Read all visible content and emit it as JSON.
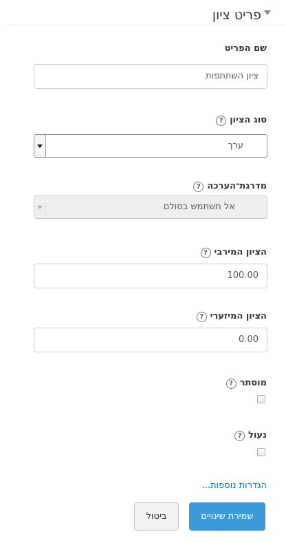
{
  "section": {
    "title": "פריט ציון"
  },
  "fields": {
    "item_name": {
      "label": "שם הפריט",
      "value": "ציון השתתפות"
    },
    "grade_type": {
      "label": "סוג הציון",
      "value": "ערך"
    },
    "scale": {
      "label": "מדרגת־הערכה",
      "value": "אל תשתמש בסולם"
    },
    "max_grade": {
      "label": "הציון המירבי",
      "value": "100.00"
    },
    "min_grade": {
      "label": "הציון המיזערי",
      "value": "0.00"
    },
    "hidden": {
      "label": "מוסתר",
      "checked": false
    },
    "locked": {
      "label": "נעול",
      "checked": false
    }
  },
  "help_glyph": "?",
  "more_settings_label": "הגדרות נוספות...",
  "buttons": {
    "save": "שמירת שינויים",
    "cancel": "ביטול"
  },
  "colors": {
    "primary": "#3d9ad8",
    "link": "#0f6fc5",
    "disabled_bg": "#eeeeee"
  }
}
